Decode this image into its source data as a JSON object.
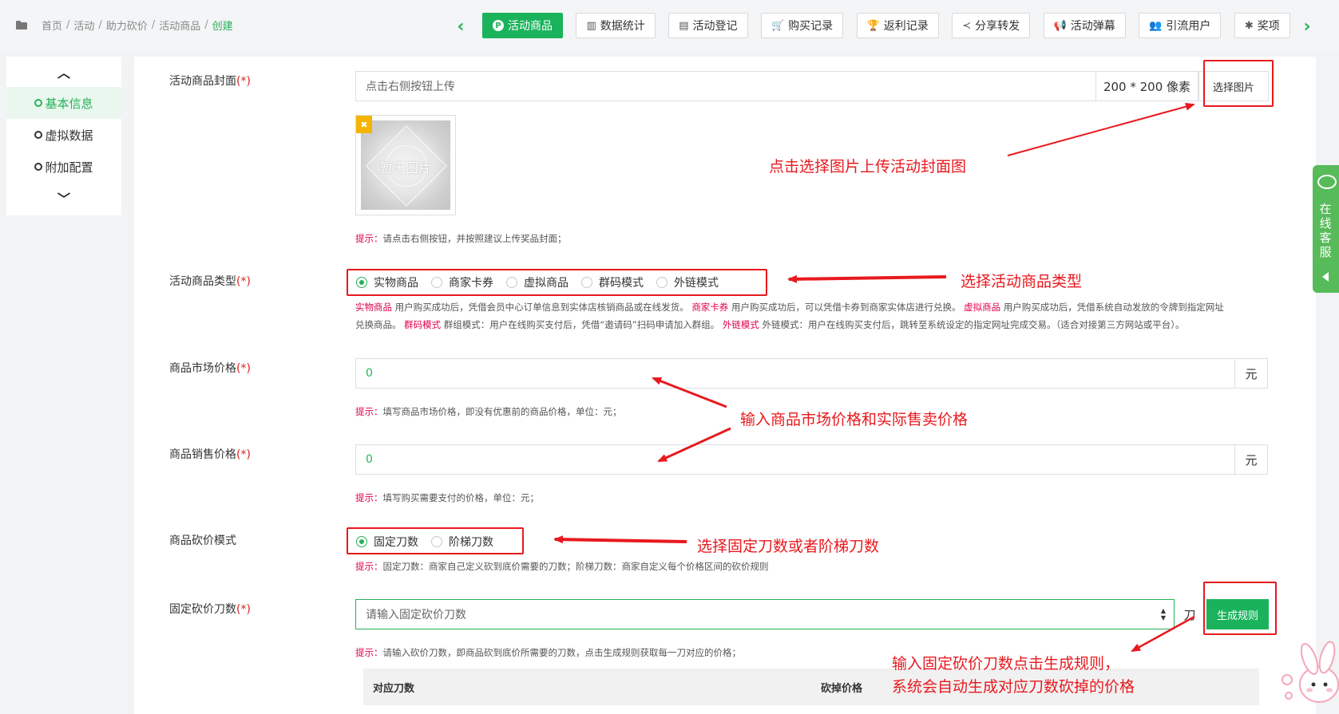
{
  "breadcrumb": {
    "items": [
      "首页",
      "活动",
      "助力砍价",
      "活动商品"
    ],
    "current": "创建",
    "separator": "/"
  },
  "toolbar": {
    "tabs": [
      {
        "label": "活动商品",
        "icon": "p-circle-icon",
        "glyph": "P",
        "active": true
      },
      {
        "label": "数据统计",
        "icon": "bar-chart-icon",
        "glyph": "▥"
      },
      {
        "label": "活动登记",
        "icon": "clipboard-icon",
        "glyph": "▤"
      },
      {
        "label": "购买记录",
        "icon": "cart-icon",
        "glyph": "🛒"
      },
      {
        "label": "返利记录",
        "icon": "trophy-icon",
        "glyph": "🏆"
      },
      {
        "label": "分享转发",
        "icon": "share-icon",
        "glyph": "≺"
      },
      {
        "label": "活动弹幕",
        "icon": "bullhorn-icon",
        "glyph": "📢"
      },
      {
        "label": "引流用户",
        "icon": "users-icon",
        "glyph": "👥"
      },
      {
        "label": "奖项",
        "icon": "bug-icon",
        "glyph": "✱"
      }
    ]
  },
  "sidenav": {
    "items": [
      {
        "label": "基本信息",
        "active": true
      },
      {
        "label": "虚拟数据"
      },
      {
        "label": "附加配置"
      }
    ]
  },
  "form": {
    "required_mark": "(*)",
    "cover": {
      "label": "活动商品封面",
      "placeholder": "点击右侧按钮上传",
      "size_hint": "200 * 200 像素",
      "button": "选择图片",
      "no_image": "暂无图片",
      "delete_glyph": "✖",
      "hint_key": "提示：",
      "hint_text": "请点击右侧按钮，并按照建议上传奖品封面；"
    },
    "type": {
      "label": "活动商品类型",
      "options": [
        "实物商品",
        "商家卡券",
        "虚拟商品",
        "群码模式",
        "外链模式"
      ],
      "selected": "实物商品",
      "desc_line1": [
        {
          "k": "实物商品",
          "t": " 用户购买成功后，凭借会员中心订单信息到实体店核销商品或在线发货。 "
        },
        {
          "k": "商家卡券",
          "t": " 用户购买成功后，可以凭借卡券到商家实体店进行兑换。 "
        },
        {
          "k": "虚拟商品",
          "t": " 用户购买成功后，凭借系统自动发放的令牌到指定网址"
        }
      ],
      "desc_line2": [
        {
          "k": "",
          "t": "兑换商品。 "
        },
        {
          "k": "群码模式",
          "t": " 群组模式：用户在线购买支付后，凭借“邀请码”扫码申请加入群组。 "
        },
        {
          "k": "外链模式",
          "t": " 外链模式：用户在线购买支付后，跳转至系统设定的指定网址完成交易。（适合对接第三方网站或平台）。"
        }
      ]
    },
    "market_price": {
      "label": "商品市场价格",
      "value": "0",
      "unit": "元",
      "hint_key": "提示：",
      "hint_text": "填写商品市场价格，即没有优惠前的商品价格，单位：元；"
    },
    "sale_price": {
      "label": "商品销售价格",
      "value": "0",
      "unit": "元",
      "hint_key": "提示：",
      "hint_text": "填写购买需要支付的价格，单位：元；"
    },
    "mode": {
      "label": "商品砍价模式",
      "options": [
        "固定刀数",
        "阶梯刀数"
      ],
      "selected": "固定刀数",
      "hint_key": "提示：",
      "hint_text": "固定刀数：商家自己定义砍到底价需要的刀数；阶梯刀数：商家自定义每个价格区间的砍价规则"
    },
    "fixed_cuts": {
      "label": "固定砍价刀数",
      "placeholder": "请输入固定砍价刀数",
      "unit": "刀",
      "button": "生成规则",
      "hint_key": "提示：",
      "hint_text": "请输入砍价刀数，即商品砍到底价所需要的刀数，点击生成规则获取每一刀对应的价格；"
    },
    "table": {
      "columns": [
        "对应刀数",
        "砍掉价格"
      ]
    }
  },
  "annotations": {
    "cover": "点击选择图片上传活动封面图",
    "type": "选择活动商品类型",
    "price": "输入商品市场价格和实际售卖价格",
    "mode": "选择固定刀数或者阶梯刀数",
    "rule_line1": "输入固定砍价刀数点击生成规则，",
    "rule_line2": "系统会自动生成对应刀数砍掉的价格"
  },
  "service": {
    "label": "在线客服"
  },
  "colors": {
    "accent": "#1ab35c",
    "annotation": "#e8191e",
    "hint_key": "#e0004d"
  }
}
